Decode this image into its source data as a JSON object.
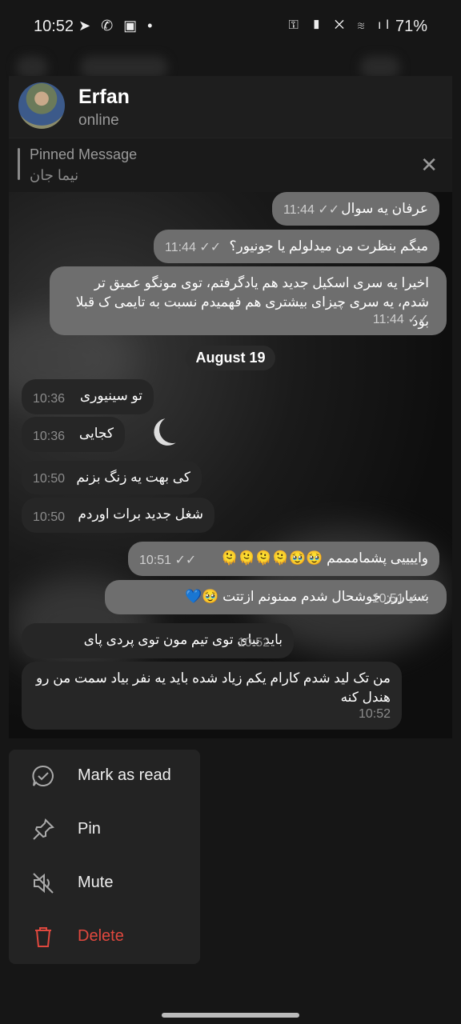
{
  "status_bar": {
    "time": "10:52",
    "battery": "71%"
  },
  "chat": {
    "name": "Erfan",
    "status": "online",
    "pinned": {
      "title": "Pinned Message",
      "text": "نیما جان"
    },
    "date_separator": "August 19",
    "messages": [
      {
        "dir": "out",
        "text": "عرفان یه سوال",
        "time": "11:44"
      },
      {
        "dir": "out",
        "text": "میگم بنظرت من میدلولم یا جونیور؟",
        "time": "11:44"
      },
      {
        "dir": "out",
        "text": "اخیرا یه سری اسکیل جدید هم یادگرفتم، توی مونگو عمیق تر شدم، یه سری چیزای بیشتری هم فهمیدم نسبت به تایمی ک قبلا بود",
        "time": "11:44"
      },
      {
        "dir": "in",
        "text": "تو سینیوری",
        "time": "10:36"
      },
      {
        "dir": "in",
        "text": "کجایی",
        "time": "10:36"
      },
      {
        "dir": "in",
        "text": "کی بهت یه زنگ بزنم",
        "time": "10:50"
      },
      {
        "dir": "in",
        "text": "شغل جدید برات اوردم",
        "time": "10:50"
      },
      {
        "dir": "out",
        "text": "واییییی پشمامممم 🥹🥹🫠🫠🫠🫠",
        "time": "10:51"
      },
      {
        "dir": "out",
        "text": "بسیاررر خوشحال شدم ممنونم ازتتت 🥹💙",
        "time": "10:51"
      },
      {
        "dir": "in",
        "text": "باید بیای توی تیم مون توی پردی پای",
        "time": "10:52"
      },
      {
        "dir": "in",
        "text": "من تک لید شدم کارام یکم زیاد شده باید یه نفر بیاد سمت من رو هندل کنه",
        "time": "10:52"
      }
    ]
  },
  "menu": {
    "items": [
      {
        "label": "Mark as read",
        "icon": "check-circle-icon"
      },
      {
        "label": "Pin",
        "icon": "pin-icon"
      },
      {
        "label": "Mute",
        "icon": "mute-icon"
      },
      {
        "label": "Delete",
        "icon": "trash-icon",
        "color": "#e0483e"
      }
    ]
  }
}
